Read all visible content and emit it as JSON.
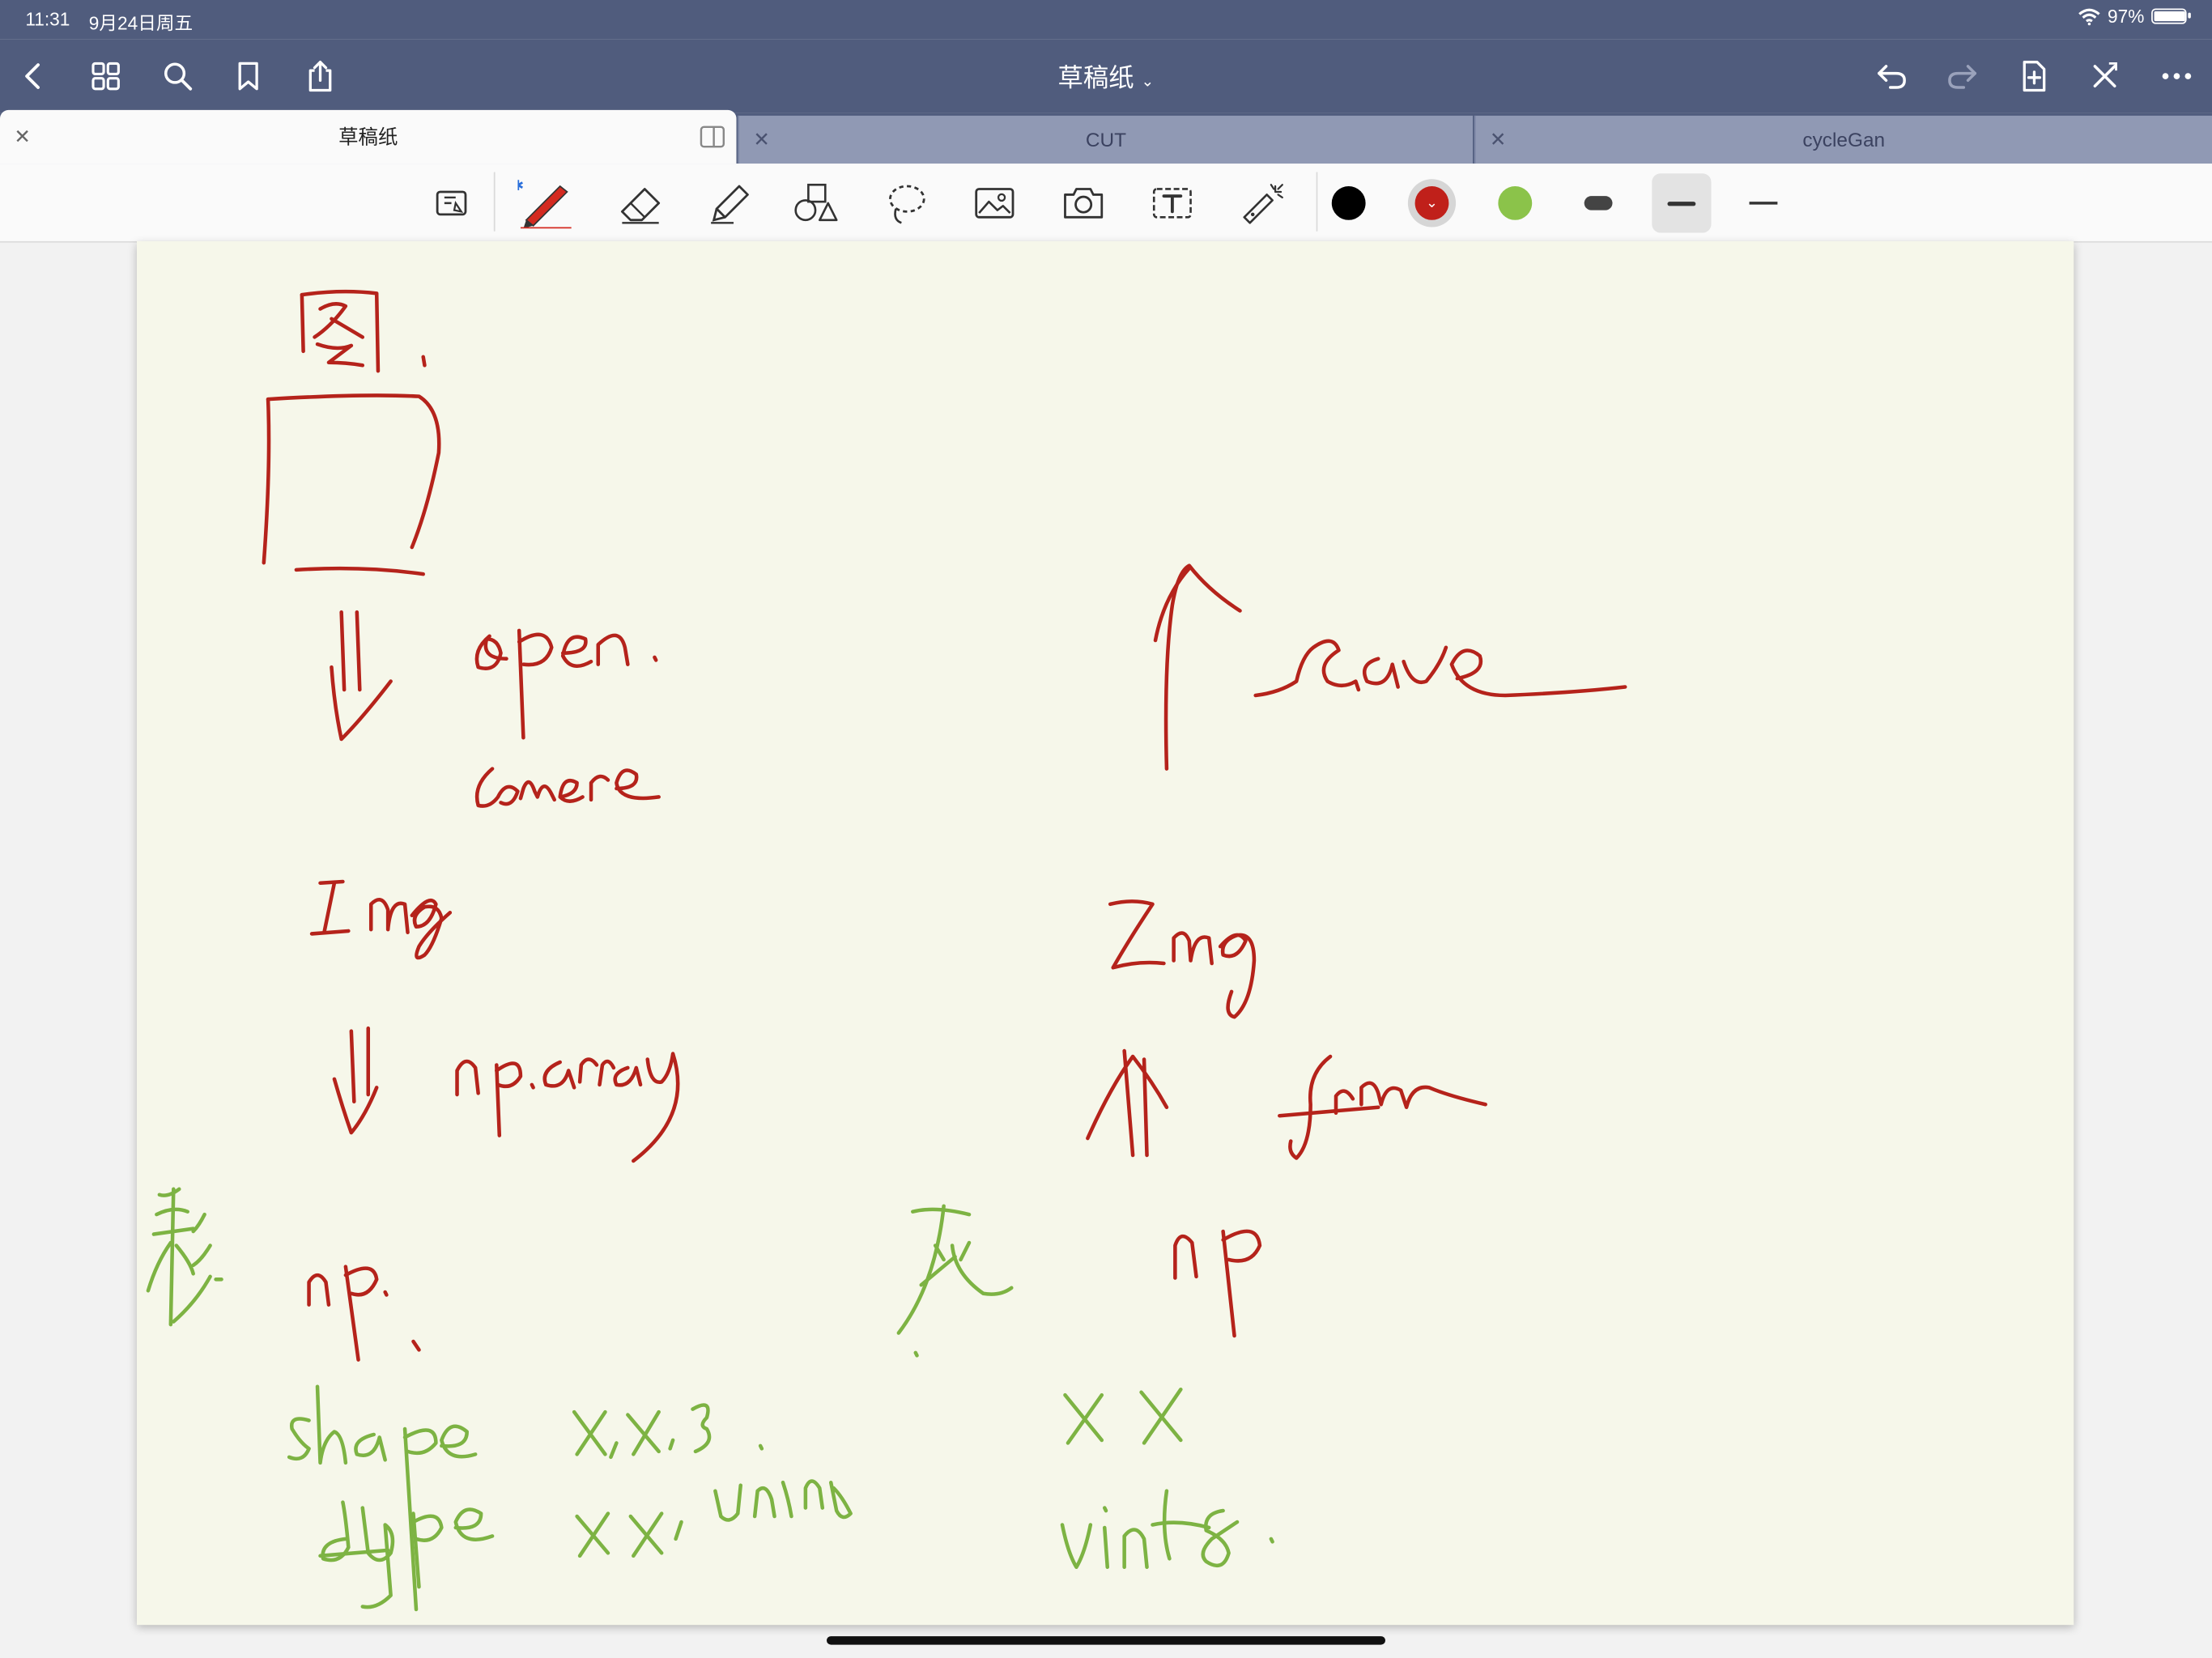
{
  "status": {
    "time": "11:31",
    "date": "9月24日周五",
    "battery_percent": "97%",
    "battery_level": 0.97
  },
  "nav": {
    "title": "草稿纸",
    "icons": [
      "back-icon",
      "grid-icon",
      "search-icon",
      "bookmark-icon",
      "share-icon",
      "undo-icon",
      "redo-icon",
      "add-page-icon",
      "close-cross-icon",
      "more-icon"
    ]
  },
  "tabs": [
    {
      "label": "草稿纸",
      "active": true
    },
    {
      "label": "CUT",
      "active": false
    },
    {
      "label": "cycleGan",
      "active": false
    }
  ],
  "toolbar": {
    "tools": [
      "read-mode-icon",
      "pen-icon",
      "eraser-icon",
      "highlighter-icon",
      "shapes-icon",
      "lasso-icon",
      "image-icon",
      "camera-icon",
      "text-box-icon",
      "laser-pointer-icon"
    ],
    "colors": {
      "black": "#000000",
      "red": "#c0201a",
      "green": "#8bc34a",
      "gray": "#444444"
    },
    "selected_color": "red"
  },
  "canvas": {
    "background": "#f6f7ea",
    "ink_red": "#b5231b",
    "ink_green": "#7db343"
  }
}
